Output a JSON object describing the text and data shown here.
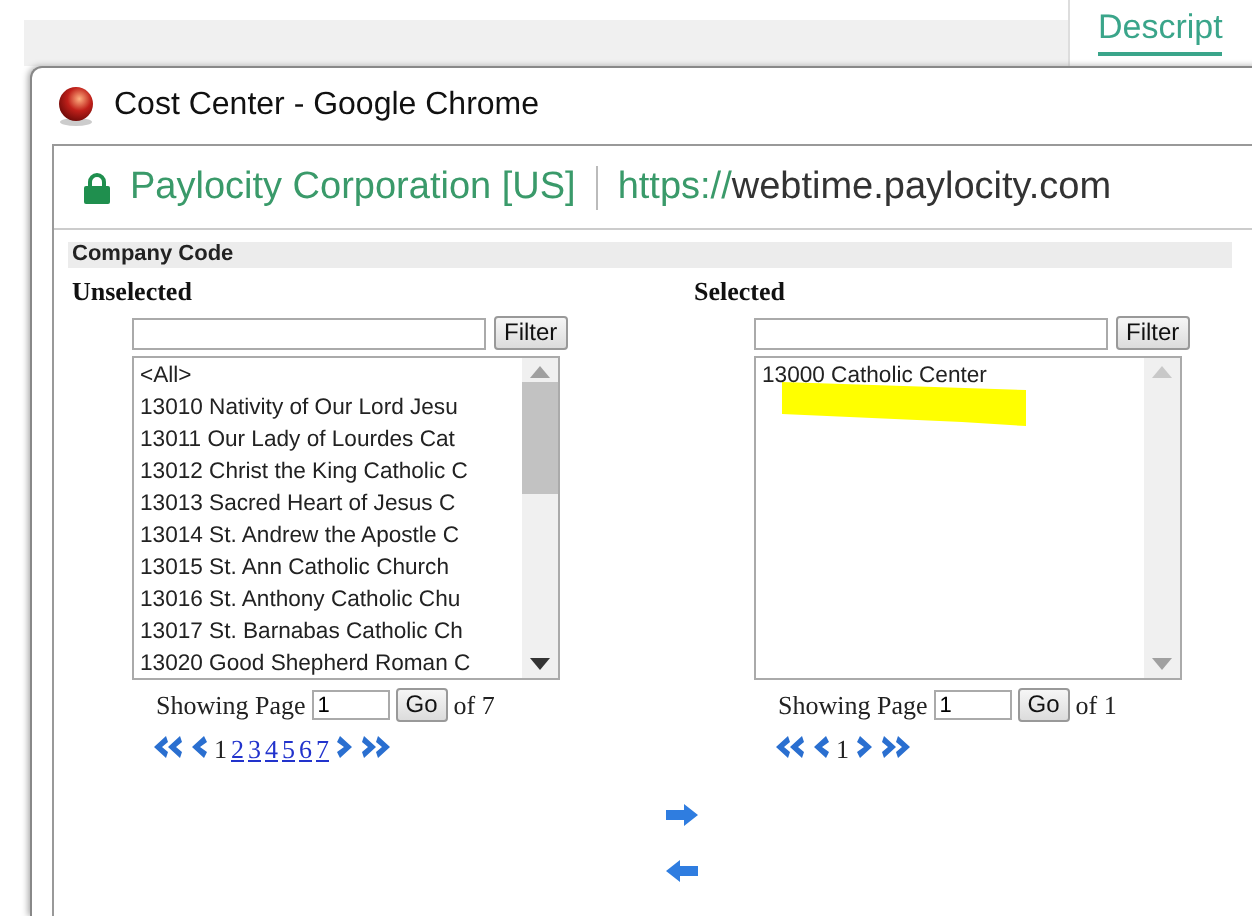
{
  "background_tab": {
    "label": "Descript"
  },
  "window": {
    "title": "Cost Center - Google Chrome"
  },
  "address_bar": {
    "site": "Paylocity Corporation [US]",
    "url_scheme": "https://",
    "url_host": "webtime.paylocity.com"
  },
  "section_title": "Company Code",
  "panels": [
    {
      "heading": "Unselected",
      "filter_button": "Filter",
      "items": [
        {
          "label": "<All>"
        },
        {
          "label": "13010 Nativity of Our Lord Jesu"
        },
        {
          "label": "13011 Our Lady of Lourdes Cat"
        },
        {
          "label": "13012 Christ the King Catholic C"
        },
        {
          "label": "13013 Sacred Heart of Jesus C"
        },
        {
          "label": "13014 St. Andrew the Apostle C"
        },
        {
          "label": "13015 St. Ann Catholic Church"
        },
        {
          "label": "13016 St. Anthony Catholic Chu"
        },
        {
          "label": "13017 St. Barnabas Catholic Ch"
        },
        {
          "label": "13020 Good Shepherd Roman C"
        }
      ],
      "page_label": "Showing Page",
      "page_value": "1",
      "go_button": "Go",
      "page_count": "of 7",
      "pages": [
        {
          "label": "1",
          "selected": true
        },
        {
          "label": "2",
          "selected": false
        },
        {
          "label": "3",
          "selected": false
        },
        {
          "label": "4",
          "selected": false
        },
        {
          "label": "5",
          "selected": false
        },
        {
          "label": "6",
          "selected": false
        },
        {
          "label": "7",
          "selected": false
        }
      ]
    },
    {
      "heading": "Selected",
      "filter_button": "Filter",
      "items": [
        {
          "label": "13000 Catholic Center"
        }
      ],
      "page_label": "Showing Page",
      "page_value": "1",
      "go_button": "Go",
      "page_count": "of 1",
      "pages": [
        {
          "label": "1",
          "selected": true
        }
      ]
    }
  ]
}
